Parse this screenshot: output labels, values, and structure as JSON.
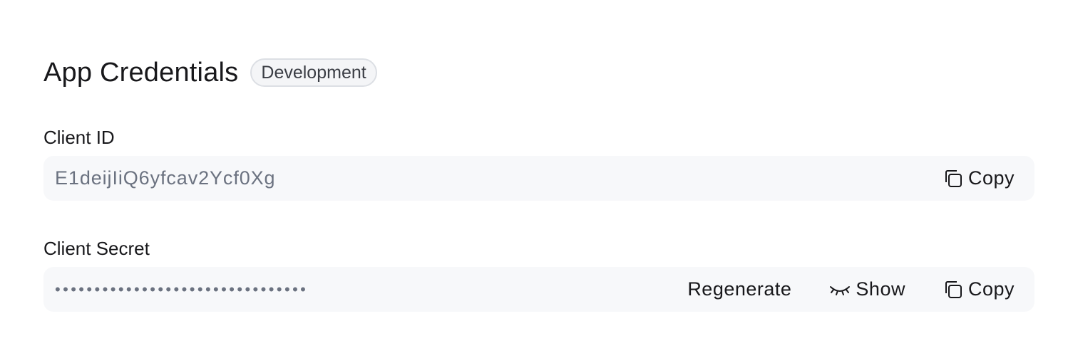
{
  "header": {
    "title": "App Credentials",
    "badge": "Development"
  },
  "client_id": {
    "label": "Client ID",
    "value": "E1deijIiQ6yfcav2Ycf0Xg",
    "copy_label": "Copy",
    "copy_icon": "copy-icon"
  },
  "client_secret": {
    "label": "Client Secret",
    "masked_value": "••••••••••••••••••••••••••••••••",
    "regenerate_label": "Regenerate",
    "show_label": "Show",
    "show_icon": "eye-closed-icon",
    "copy_label": "Copy",
    "copy_icon": "copy-icon"
  }
}
